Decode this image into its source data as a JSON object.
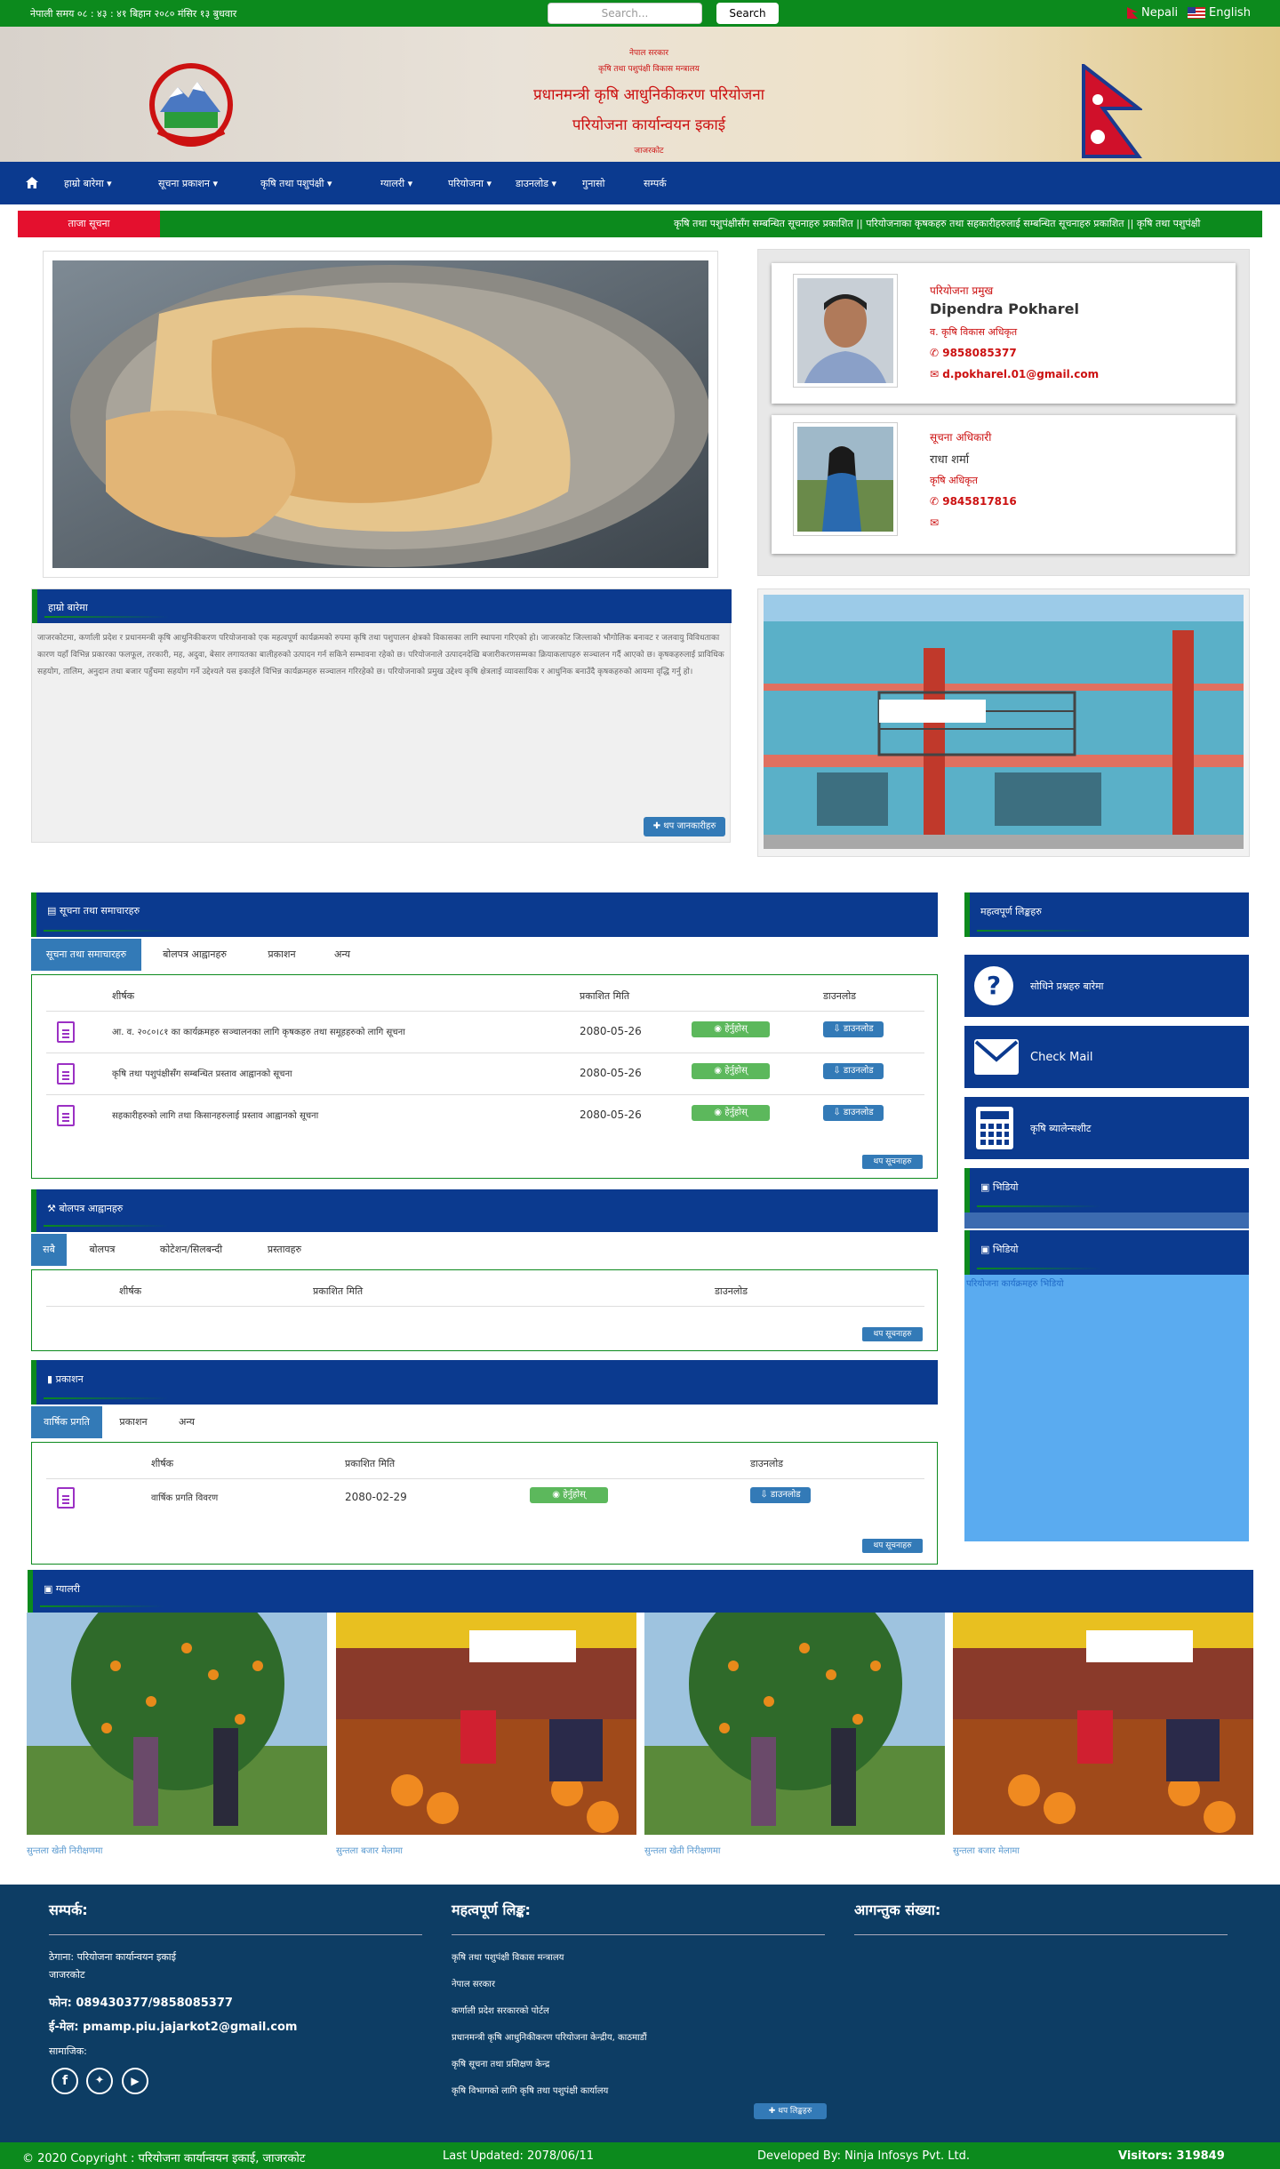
{
  "topbar": {
    "time": "नेपाली समय ०८ : ४३ : ४१ बिहान  २०८० मंसिर १३ बुधवार",
    "search_placeholder": "Search...",
    "search_button": "Search",
    "lang_nepali": "Nepali",
    "lang_english": "English"
  },
  "header": {
    "line1": "नेपाल सरकार",
    "line2": "कृषि तथा पशुपंक्षी विकास मन्त्रालय",
    "title1": "प्रधानमन्त्री कृषि आधुनिकीकरण परियोजना",
    "title2": "परियोजना कार्यान्वयन इकाई",
    "line3": "जाजरकोट"
  },
  "nav": {
    "home_icon": "home-icon",
    "items": [
      "हाम्रो बारेमा",
      "सूचना प्रकाशन",
      "कृषि तथा पशुपंक्षी",
      "ग्यालरी",
      "परियोजना",
      "डाउनलोड",
      "गुनासो",
      "सम्पर्क"
    ]
  },
  "ticker": {
    "label": "ताजा सूचना",
    "text": "कृषि तथा पशुपंक्षीसँग सम्बन्धित सूचनाहरु प्रकाशित  || परियोजनाका कृषकहरु तथा सहकारीहरुलाई सम्बन्धित सूचनाहरु प्रकाशित  || कृषि तथा पशुपंक्षी"
  },
  "intro": {
    "heading": "हाम्रो बारेमा",
    "body": "जाजरकोटमा, कर्णाली प्रदेश र प्रधानमन्त्री कृषि आधुनिकीकरण परियोजनाको एक महत्वपूर्ण कार्यक्रमको रुपमा कृषि तथा पशुपालन क्षेत्रको विकासका लागि स्थापना गरिएको हो। जाजरकोट जिल्लाको भौगोलिक बनावट र जलवायु विविधताका कारण यहाँ विभिन्न प्रकारका फलफूल, तरकारी, मह, अदुवा, बेसार लगायतका बालीहरुको उत्पादन गर्न सकिने सम्भावना रहेको छ। परियोजनाले उत्पादनदेखि बजारीकरणसम्मका क्रियाकलापहरु सञ्चालन गर्दै आएको छ। कृषकहरुलाई प्राविधिक सहयोग, तालिम, अनुदान तथा बजार पहुँचमा सहयोग गर्ने उद्देश्यले यस इकाईले विभिन्न कार्यक्रमहरु सञ्चालन गरिरहेको छ। परियोजनाको प्रमुख उद्देश्य कृषि क्षेत्रलाई व्यावसायिक र आधुनिक बनाउँदै कृषकहरुको आयमा वृद्धि गर्नु हो।",
    "more_button": "थप जानकारीहरु"
  },
  "staff": [
    {
      "role": "परियोजना प्रमुख",
      "name": "Dipendra Pokharel",
      "title": "व. कृषि विकास अधिकृत",
      "phone": "9858085377",
      "email": "d.pokharel.01@gmail.com"
    },
    {
      "role": "सूचना अधिकारी",
      "name": "राधा शर्मा",
      "title": "कृषि अधिकृत",
      "phone": "9845817816",
      "email": ""
    }
  ],
  "news": {
    "heading": "सूचना तथा समाचारहरु",
    "tabs": [
      "सूचना तथा समाचारहरु",
      "बोलपत्र आह्वानहरु",
      "प्रकाशन",
      "अन्य"
    ],
    "columns": [
      "शीर्षक",
      "प्रकाशित मिति",
      "डाउनलोड"
    ],
    "rows": [
      {
        "title": "आ. व. २०८०।८१ का कार्यक्रमहरु सञ्चालनका लागि कृषकहरु तथा समूहहरुको लागि सूचना",
        "date": "2080-05-26",
        "view": "हेर्नुहोस्",
        "download": "डाउनलोड"
      },
      {
        "title": "कृषि तथा पशुपंक्षीसँग सम्बन्धित प्रस्ताव आह्वानको सूचना",
        "date": "2080-05-26",
        "view": "हेर्नुहोस्",
        "download": "डाउनलोड"
      },
      {
        "title": "सहकारीहरुको लागि तथा किसानहरुलाई प्रस्ताव आह्वानको सूचना",
        "date": "2080-05-26",
        "view": "हेर्नुहोस्",
        "download": "डाउनलोड"
      }
    ],
    "more": "थप सूचनाहरु"
  },
  "tenders": {
    "heading": "बोलपत्र आह्वानहरु",
    "tabs": [
      "सबै",
      "बोलपत्र",
      "कोटेशन/सिलबन्दी",
      "प्रस्तावहरु"
    ],
    "columns": [
      "शीर्षक",
      "प्रकाशित मिति",
      "डाउनलोड"
    ],
    "more": "थप सूचनाहरु"
  },
  "publications": {
    "heading": "प्रकाशन",
    "tabs": [
      "वार्षिक प्रगति",
      "प्रकाशन",
      "अन्य"
    ],
    "columns": [
      "शीर्षक",
      "प्रकाशित मिति",
      "डाउनलोड"
    ],
    "rows": [
      {
        "title": "वार्षिक प्रगति विवरण",
        "date": "2080-02-29",
        "view": "हेर्नुहोस्",
        "download": "डाउनलोड"
      }
    ],
    "more": "थप सूचनाहरु"
  },
  "sidebar": {
    "heading": "महत्वपूर्ण लिङ्कहरु",
    "links": [
      {
        "icon": "question-icon",
        "label": "सोधिने प्रश्नहरु बारेमा"
      },
      {
        "icon": "mail-icon",
        "label": "Check Mail"
      },
      {
        "icon": "calculator-icon",
        "label": "कृषि ब्यालेन्सशीट"
      }
    ],
    "widget1": "भिडियो",
    "widget2": "भिडियो",
    "widget2_link": "परियोजना कार्यक्रमहरु भिडियो"
  },
  "gallery": {
    "heading": "ग्यालरी",
    "items": [
      {
        "caption": "सुन्तला खेती निरीक्षणमा"
      },
      {
        "caption": "सुन्तला बजार मेलामा"
      },
      {
        "caption": "सुन्तला खेती निरीक्षणमा"
      },
      {
        "caption": "सुन्तला बजार मेलामा"
      }
    ]
  },
  "footer": {
    "contact_heading": "सम्पर्क:",
    "address": "ठेगाना: परियोजना कार्यान्वयन इकाई",
    "address2": "जाजरकोट",
    "phone": "फोन: 089430377/9858085377",
    "email": "ई-मेल: pmamp.piu.jajarkot2@gmail.com",
    "social_label": "सामाजिक:",
    "links_heading": "महत्वपूर्ण लिङ्क:",
    "links": [
      "कृषि तथा पशुपंक्षी विकास मन्त्रालय",
      "नेपाल सरकार",
      "कर्णाली प्रदेश सरकारको पोर्टल",
      "प्रधानमन्त्री कृषि आधुनिकीकरण परियोजना केन्द्रीय, काठमाडौं",
      "कृषि सूचना तथा प्रशिक्षण केन्द्र",
      "कृषि विभागको लागि कृषि तथा पशुपंक्षी कार्यालय"
    ],
    "links_more": "थप लिङ्कहरु",
    "visitors_heading": "आगन्तुक संख्या:"
  },
  "copyright": {
    "text": "© 2020 Copyright : परियोजना कार्यान्वयन इकाई, जाजरकोट",
    "updated": "Last Updated: 2078/06/11",
    "developed": "Developed By: Ninja Infosys Pvt. Ltd.",
    "visitors": "Visitors: 319849"
  },
  "colors": {
    "green": "#0c8a1d",
    "navy": "#0b3a8f",
    "red": "#e4102e",
    "footer": "#0d3d64",
    "button_blue": "#337ab7"
  }
}
